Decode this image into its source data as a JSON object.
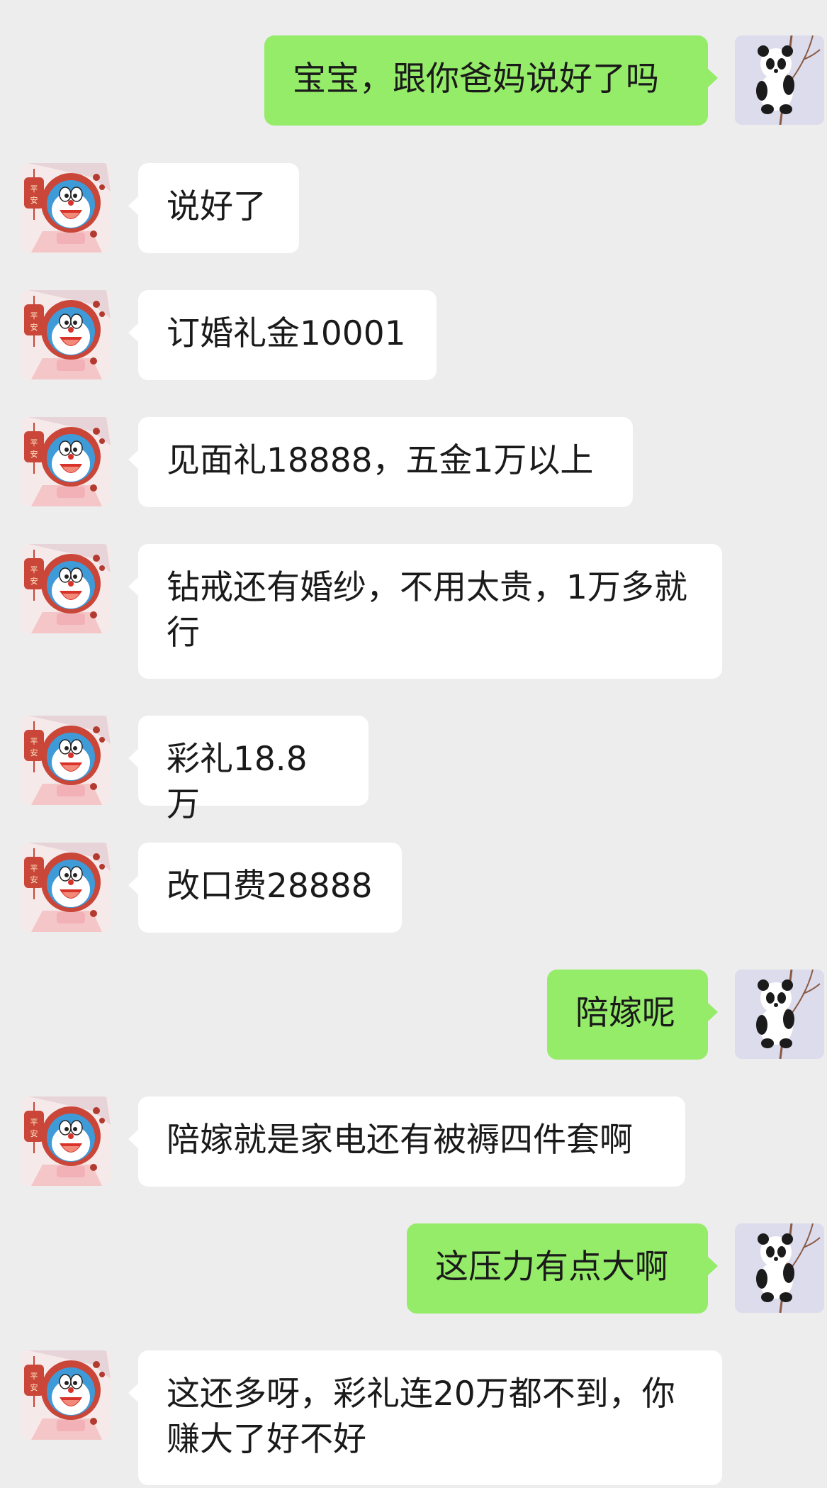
{
  "messages": [
    {
      "side": "right",
      "text": "宝宝，跟你爸妈说好了吗"
    },
    {
      "side": "left",
      "text": "说好了"
    },
    {
      "side": "left",
      "text": "订婚礼金10001"
    },
    {
      "side": "left",
      "text": "见面礼18888，五金1万以上"
    },
    {
      "side": "left",
      "text": "钻戒还有婚纱，不用太贵，1万多就行"
    },
    {
      "side": "left",
      "text": "彩礼18.8万"
    },
    {
      "side": "left",
      "text": "改口费28888"
    },
    {
      "side": "right",
      "text": "陪嫁呢"
    },
    {
      "side": "left",
      "text": "陪嫁就是家电还有被褥四件套啊"
    },
    {
      "side": "right",
      "text": "这压力有点大啊"
    },
    {
      "side": "left",
      "text": "这还多呀，彩礼连20万都不到，你赚大了好不好"
    }
  ],
  "avatars": {
    "left": {
      "icon": "doraemon-avatar-icon",
      "charm_text": "平安"
    },
    "right": {
      "icon": "panda-avatar-icon"
    }
  },
  "colors": {
    "background": "#ededed",
    "self_bubble": "#95ec69",
    "other_bubble": "#ffffff"
  }
}
